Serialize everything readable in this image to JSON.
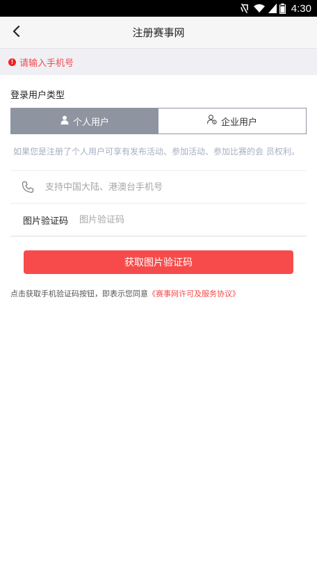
{
  "status_bar": {
    "time": "4:30",
    "icons": [
      "vibrate-icon",
      "wifi-icon",
      "signal-icon",
      "battery-icon"
    ]
  },
  "nav": {
    "back_icon": "chevron-left-icon",
    "title": "注册赛事网"
  },
  "error": {
    "icon": "alert-circle-icon",
    "message": "请输入手机号"
  },
  "user_type": {
    "label": "登录用户类型",
    "options": [
      {
        "label": "个人用户",
        "icon": "person-icon",
        "selected": true
      },
      {
        "label": "企业用户",
        "icon": "enterprise-user-icon",
        "selected": false
      }
    ]
  },
  "description": "如果您是注册了个人用户可享有发布活动、参加活动、参加比赛的会 员权利。",
  "form": {
    "phone_placeholder": "支持中国大陆、港澳台手机号",
    "captcha_label": "图片验证码",
    "captcha_placeholder": "图片验证码"
  },
  "submit_label": "获取图片验证码",
  "agreement": {
    "prefix": "点击获取手机验证码按钮，即表示您同意",
    "link": "《赛事网许可及服务协议》"
  },
  "colors": {
    "accent_red": "#f74b4b",
    "toggle_gray": "#8e95a1",
    "hint_blue_gray": "#a6aebf"
  }
}
